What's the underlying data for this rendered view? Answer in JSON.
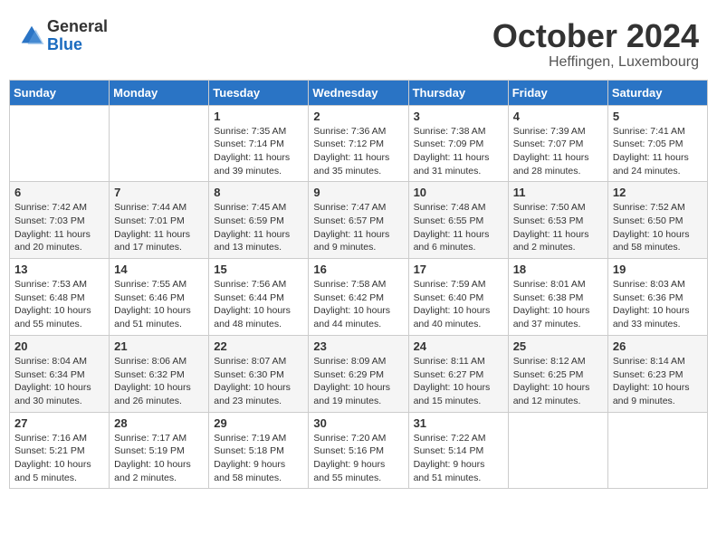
{
  "header": {
    "logo_general": "General",
    "logo_blue": "Blue",
    "month": "October 2024",
    "location": "Heffingen, Luxembourg"
  },
  "days_of_week": [
    "Sunday",
    "Monday",
    "Tuesday",
    "Wednesday",
    "Thursday",
    "Friday",
    "Saturday"
  ],
  "weeks": [
    [
      {
        "day": "",
        "sunrise": "",
        "sunset": "",
        "daylight": ""
      },
      {
        "day": "",
        "sunrise": "",
        "sunset": "",
        "daylight": ""
      },
      {
        "day": "1",
        "sunrise": "Sunrise: 7:35 AM",
        "sunset": "Sunset: 7:14 PM",
        "daylight": "Daylight: 11 hours and 39 minutes."
      },
      {
        "day": "2",
        "sunrise": "Sunrise: 7:36 AM",
        "sunset": "Sunset: 7:12 PM",
        "daylight": "Daylight: 11 hours and 35 minutes."
      },
      {
        "day": "3",
        "sunrise": "Sunrise: 7:38 AM",
        "sunset": "Sunset: 7:09 PM",
        "daylight": "Daylight: 11 hours and 31 minutes."
      },
      {
        "day": "4",
        "sunrise": "Sunrise: 7:39 AM",
        "sunset": "Sunset: 7:07 PM",
        "daylight": "Daylight: 11 hours and 28 minutes."
      },
      {
        "day": "5",
        "sunrise": "Sunrise: 7:41 AM",
        "sunset": "Sunset: 7:05 PM",
        "daylight": "Daylight: 11 hours and 24 minutes."
      }
    ],
    [
      {
        "day": "6",
        "sunrise": "Sunrise: 7:42 AM",
        "sunset": "Sunset: 7:03 PM",
        "daylight": "Daylight: 11 hours and 20 minutes."
      },
      {
        "day": "7",
        "sunrise": "Sunrise: 7:44 AM",
        "sunset": "Sunset: 7:01 PM",
        "daylight": "Daylight: 11 hours and 17 minutes."
      },
      {
        "day": "8",
        "sunrise": "Sunrise: 7:45 AM",
        "sunset": "Sunset: 6:59 PM",
        "daylight": "Daylight: 11 hours and 13 minutes."
      },
      {
        "day": "9",
        "sunrise": "Sunrise: 7:47 AM",
        "sunset": "Sunset: 6:57 PM",
        "daylight": "Daylight: 11 hours and 9 minutes."
      },
      {
        "day": "10",
        "sunrise": "Sunrise: 7:48 AM",
        "sunset": "Sunset: 6:55 PM",
        "daylight": "Daylight: 11 hours and 6 minutes."
      },
      {
        "day": "11",
        "sunrise": "Sunrise: 7:50 AM",
        "sunset": "Sunset: 6:53 PM",
        "daylight": "Daylight: 11 hours and 2 minutes."
      },
      {
        "day": "12",
        "sunrise": "Sunrise: 7:52 AM",
        "sunset": "Sunset: 6:50 PM",
        "daylight": "Daylight: 10 hours and 58 minutes."
      }
    ],
    [
      {
        "day": "13",
        "sunrise": "Sunrise: 7:53 AM",
        "sunset": "Sunset: 6:48 PM",
        "daylight": "Daylight: 10 hours and 55 minutes."
      },
      {
        "day": "14",
        "sunrise": "Sunrise: 7:55 AM",
        "sunset": "Sunset: 6:46 PM",
        "daylight": "Daylight: 10 hours and 51 minutes."
      },
      {
        "day": "15",
        "sunrise": "Sunrise: 7:56 AM",
        "sunset": "Sunset: 6:44 PM",
        "daylight": "Daylight: 10 hours and 48 minutes."
      },
      {
        "day": "16",
        "sunrise": "Sunrise: 7:58 AM",
        "sunset": "Sunset: 6:42 PM",
        "daylight": "Daylight: 10 hours and 44 minutes."
      },
      {
        "day": "17",
        "sunrise": "Sunrise: 7:59 AM",
        "sunset": "Sunset: 6:40 PM",
        "daylight": "Daylight: 10 hours and 40 minutes."
      },
      {
        "day": "18",
        "sunrise": "Sunrise: 8:01 AM",
        "sunset": "Sunset: 6:38 PM",
        "daylight": "Daylight: 10 hours and 37 minutes."
      },
      {
        "day": "19",
        "sunrise": "Sunrise: 8:03 AM",
        "sunset": "Sunset: 6:36 PM",
        "daylight": "Daylight: 10 hours and 33 minutes."
      }
    ],
    [
      {
        "day": "20",
        "sunrise": "Sunrise: 8:04 AM",
        "sunset": "Sunset: 6:34 PM",
        "daylight": "Daylight: 10 hours and 30 minutes."
      },
      {
        "day": "21",
        "sunrise": "Sunrise: 8:06 AM",
        "sunset": "Sunset: 6:32 PM",
        "daylight": "Daylight: 10 hours and 26 minutes."
      },
      {
        "day": "22",
        "sunrise": "Sunrise: 8:07 AM",
        "sunset": "Sunset: 6:30 PM",
        "daylight": "Daylight: 10 hours and 23 minutes."
      },
      {
        "day": "23",
        "sunrise": "Sunrise: 8:09 AM",
        "sunset": "Sunset: 6:29 PM",
        "daylight": "Daylight: 10 hours and 19 minutes."
      },
      {
        "day": "24",
        "sunrise": "Sunrise: 8:11 AM",
        "sunset": "Sunset: 6:27 PM",
        "daylight": "Daylight: 10 hours and 15 minutes."
      },
      {
        "day": "25",
        "sunrise": "Sunrise: 8:12 AM",
        "sunset": "Sunset: 6:25 PM",
        "daylight": "Daylight: 10 hours and 12 minutes."
      },
      {
        "day": "26",
        "sunrise": "Sunrise: 8:14 AM",
        "sunset": "Sunset: 6:23 PM",
        "daylight": "Daylight: 10 hours and 9 minutes."
      }
    ],
    [
      {
        "day": "27",
        "sunrise": "Sunrise: 7:16 AM",
        "sunset": "Sunset: 5:21 PM",
        "daylight": "Daylight: 10 hours and 5 minutes."
      },
      {
        "day": "28",
        "sunrise": "Sunrise: 7:17 AM",
        "sunset": "Sunset: 5:19 PM",
        "daylight": "Daylight: 10 hours and 2 minutes."
      },
      {
        "day": "29",
        "sunrise": "Sunrise: 7:19 AM",
        "sunset": "Sunset: 5:18 PM",
        "daylight": "Daylight: 9 hours and 58 minutes."
      },
      {
        "day": "30",
        "sunrise": "Sunrise: 7:20 AM",
        "sunset": "Sunset: 5:16 PM",
        "daylight": "Daylight: 9 hours and 55 minutes."
      },
      {
        "day": "31",
        "sunrise": "Sunrise: 7:22 AM",
        "sunset": "Sunset: 5:14 PM",
        "daylight": "Daylight: 9 hours and 51 minutes."
      },
      {
        "day": "",
        "sunrise": "",
        "sunset": "",
        "daylight": ""
      },
      {
        "day": "",
        "sunrise": "",
        "sunset": "",
        "daylight": ""
      }
    ]
  ]
}
